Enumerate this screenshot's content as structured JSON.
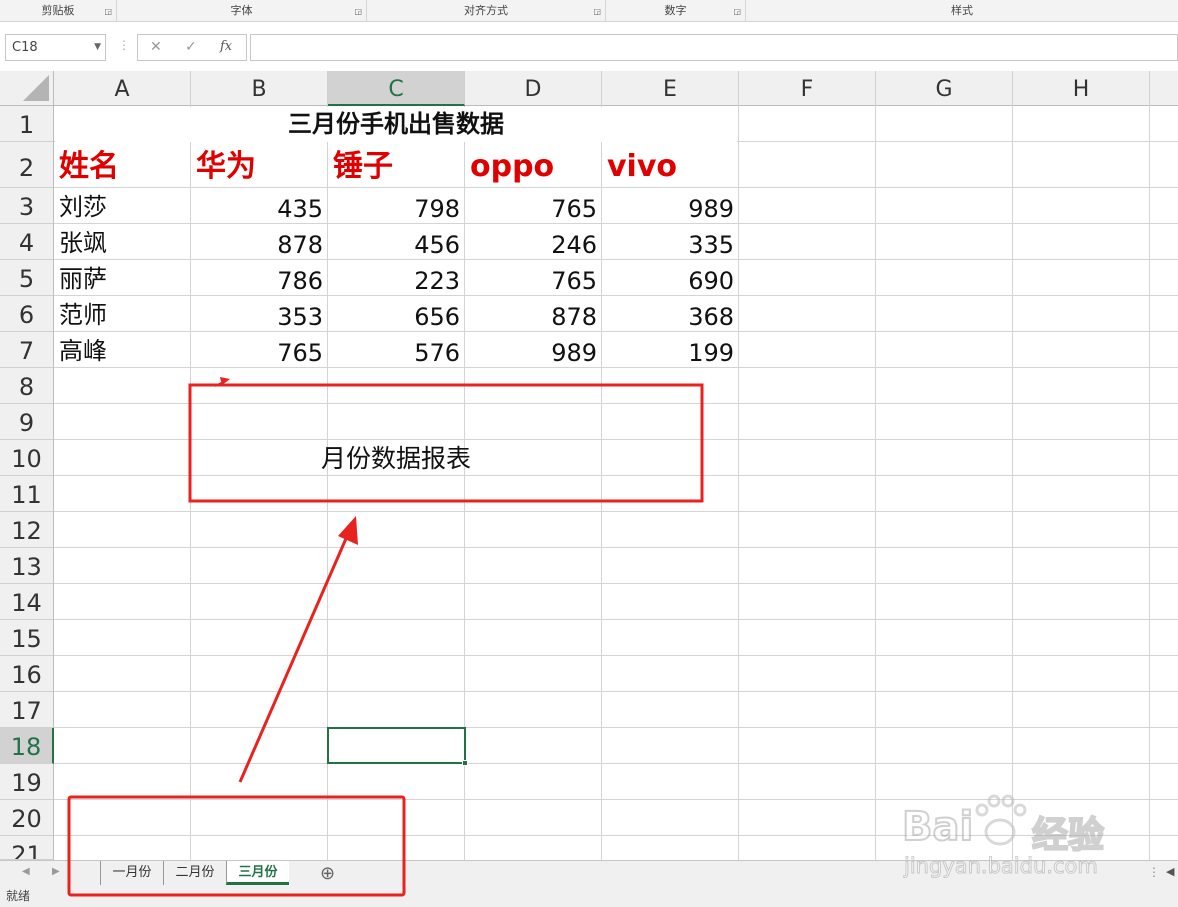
{
  "ribbon": {
    "groups": [
      "剪贴板",
      "字体",
      "对齐方式",
      "数字",
      "样式"
    ]
  },
  "formula_bar": {
    "name_box": "C18",
    "cancel_glyph": "✕",
    "enter_glyph": "✓",
    "fx_glyph": "fx",
    "formula": ""
  },
  "columns": [
    "A",
    "B",
    "C",
    "D",
    "E",
    "F",
    "G",
    "H"
  ],
  "selected_column": "C",
  "rows": [
    "1",
    "2",
    "3",
    "4",
    "5",
    "6",
    "7",
    "8",
    "9",
    "10",
    "11",
    "12",
    "13",
    "14",
    "15",
    "16",
    "17",
    "18",
    "19",
    "20",
    "21"
  ],
  "selected_row": "18",
  "sheet": {
    "title": "三月份手机出售数据",
    "headers": [
      "姓名",
      "华为",
      "锤子",
      "oppo",
      "vivo"
    ],
    "data": [
      {
        "name": "刘莎",
        "values": [
          "435",
          "798",
          "765",
          "989"
        ]
      },
      {
        "name": "张飒",
        "values": [
          "878",
          "456",
          "246",
          "335"
        ]
      },
      {
        "name": "丽萨",
        "values": [
          "786",
          "223",
          "765",
          "690"
        ]
      },
      {
        "name": "范师",
        "values": [
          "353",
          "656",
          "878",
          "368"
        ]
      },
      {
        "name": "高峰",
        "values": [
          "765",
          "576",
          "989",
          "199"
        ]
      }
    ]
  },
  "annotation": {
    "text": "月份数据报表",
    "color": "#e8231f"
  },
  "tabs": [
    "一月份",
    "二月份",
    "三月份"
  ],
  "active_tab": "三月份",
  "add_sheet_glyph": "⊕",
  "status": "就绪",
  "watermark": {
    "brand_left": "Bai",
    "brand_right": "经验",
    "site": "jingyan.baidu.com"
  },
  "colors": {
    "accent": "#217346",
    "header_red": "#e00000"
  }
}
